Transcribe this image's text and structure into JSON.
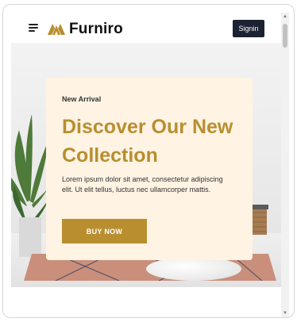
{
  "header": {
    "brand": "Furniro",
    "signin_label": "Signin"
  },
  "hero": {
    "eyebrow": "New Arrival",
    "headline": "Discover Our New Collection",
    "body": "Lorem ipsum dolor sit amet, consectetur adipiscing elit. Ut elit tellus, luctus nec ullamcorper mattis.",
    "cta_label": "BUY NOW"
  },
  "colors": {
    "accent": "#b88e2f",
    "card_bg": "#fff3e3",
    "signin_bg": "#1a2233"
  },
  "icons": {
    "menu": "hamburger-icon",
    "logo": "furniro-logo-icon",
    "scroll_up": "chevron-up-icon",
    "scroll_down": "chevron-down-icon"
  }
}
